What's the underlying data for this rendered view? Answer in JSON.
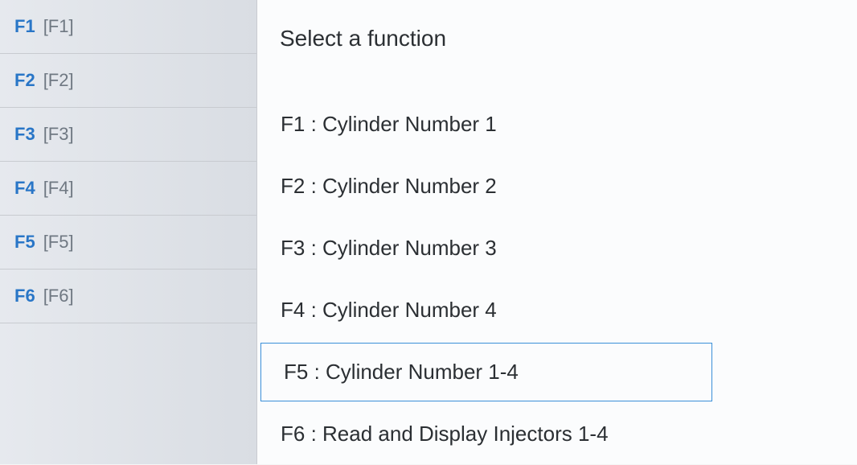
{
  "sidebar": {
    "items": [
      {
        "key": "F1",
        "bracket": "[F1]"
      },
      {
        "key": "F2",
        "bracket": "[F2]"
      },
      {
        "key": "F3",
        "bracket": "[F3]"
      },
      {
        "key": "F4",
        "bracket": "[F4]"
      },
      {
        "key": "F5",
        "bracket": "[F5]"
      },
      {
        "key": "F6",
        "bracket": "[F6]"
      }
    ]
  },
  "main": {
    "header": "Select a function",
    "items": [
      {
        "label": "F1 : Cylinder Number 1",
        "selected": false
      },
      {
        "label": "F2 : Cylinder Number 2",
        "selected": false
      },
      {
        "label": "F3 : Cylinder Number 3",
        "selected": false
      },
      {
        "label": "F4 : Cylinder Number 4",
        "selected": false
      },
      {
        "label": "F5 : Cylinder Number 1-4",
        "selected": true
      },
      {
        "label": "F6 : Read and Display Injectors 1-4",
        "selected": false
      }
    ]
  }
}
